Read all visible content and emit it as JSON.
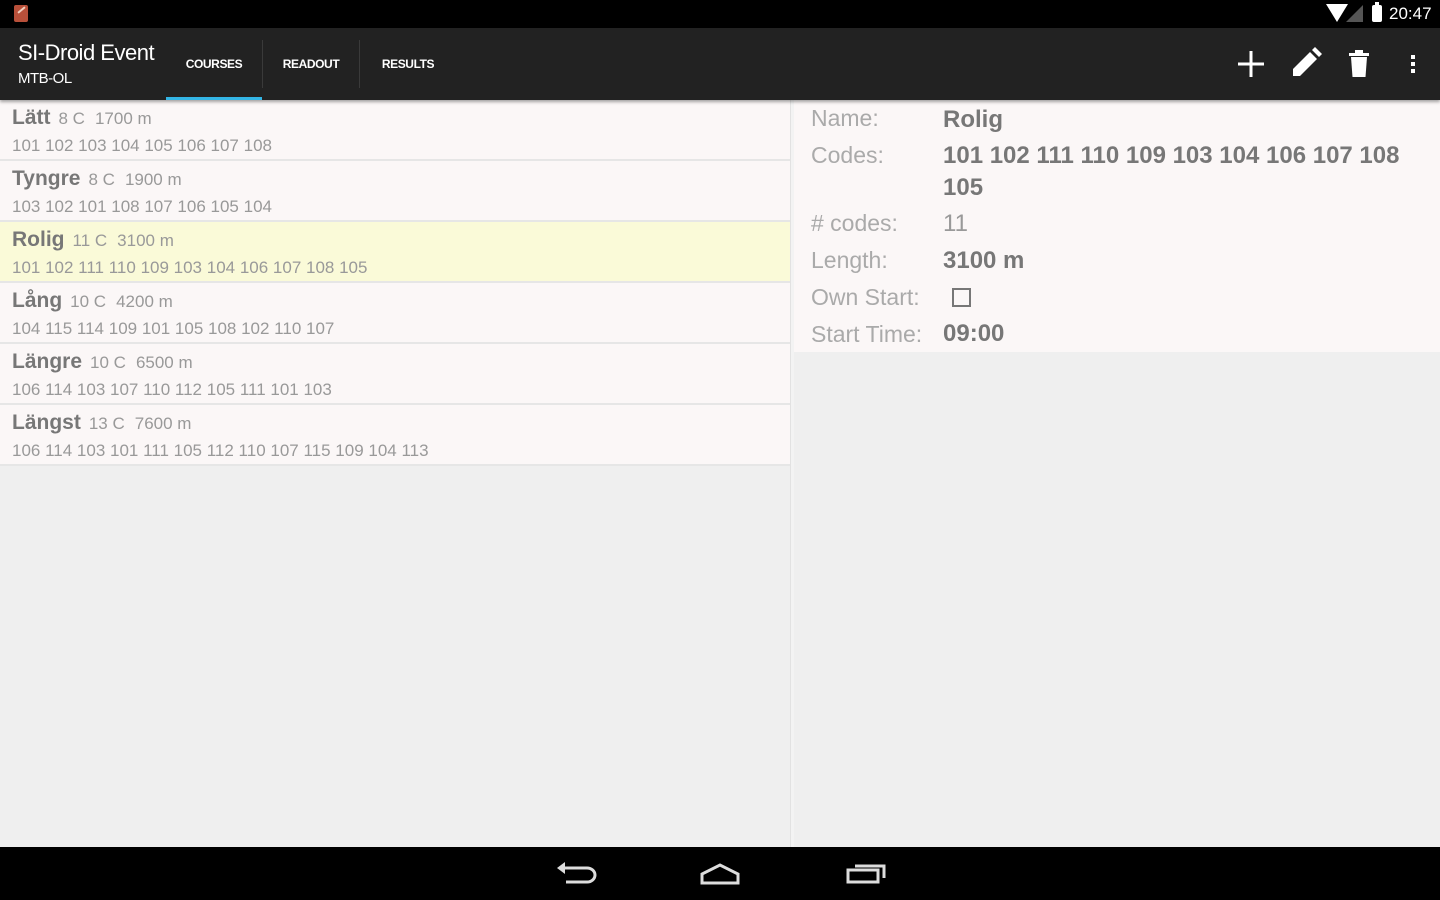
{
  "status_bar": {
    "time": "20:47"
  },
  "action_bar": {
    "title": "SI-Droid Event",
    "subtitle": "MTB-OL",
    "tabs": [
      {
        "label": "COURSES",
        "selected": true
      },
      {
        "label": "READOUT",
        "selected": false
      },
      {
        "label": "RESULTS",
        "selected": false
      }
    ],
    "actions": [
      "add-icon",
      "edit-icon",
      "delete-icon",
      "overflow-menu-icon"
    ]
  },
  "courses": [
    {
      "name": "Lätt",
      "controls": "8 C",
      "length": "1700 m",
      "codes": "101 102 103 104 105 106 107 108",
      "selected": false
    },
    {
      "name": "Tyngre",
      "controls": "8 C",
      "length": "1900 m",
      "codes": "103 102 101 108 107 106 105 104",
      "selected": false
    },
    {
      "name": "Rolig",
      "controls": "11 C",
      "length": "3100 m",
      "codes": "101 102 111 110 109 103 104 106 107 108 105",
      "selected": true
    },
    {
      "name": "Lång",
      "controls": "10 C",
      "length": "4200 m",
      "codes": "104 115 114 109 101 105 108 102 110 107",
      "selected": false
    },
    {
      "name": "Längre",
      "controls": "10 C",
      "length": "6500 m",
      "codes": "106 114 103 107 110 112 105 111 101 103",
      "selected": false
    },
    {
      "name": "Längst",
      "controls": "13 C",
      "length": "7600 m",
      "codes": "106 114 103 101 111 105 112 110 107 115 109 104 113",
      "selected": false
    }
  ],
  "details": {
    "name_label": "Name:",
    "name_value": "Rolig",
    "codes_label": "Codes:",
    "codes_value": "101 102 111 110 109 103 104 106 107 108 105",
    "count_label": "# codes:",
    "count_value": "11",
    "length_label": "Length:",
    "length_value": "3100 m",
    "own_start_label": "Own Start:",
    "own_start_checked": false,
    "start_time_label": "Start Time:",
    "start_time_value": "09:00"
  },
  "nav_bar": [
    "back-icon",
    "home-icon",
    "recent-apps-icon"
  ],
  "colors": {
    "tab_indicator": "#33b5e5",
    "selected_row": "#fafad8",
    "action_bar": "#222222"
  }
}
